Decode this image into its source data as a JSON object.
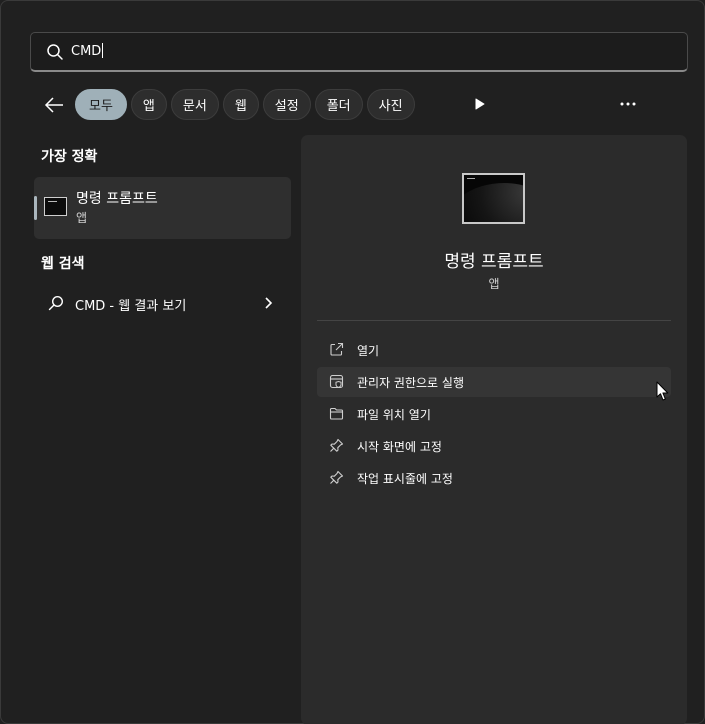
{
  "search": {
    "value": "CMD"
  },
  "filters": [
    "모두",
    "앱",
    "문서",
    "웹",
    "설정",
    "폴더",
    "사진"
  ],
  "best_match": {
    "heading": "가장 정확",
    "name": "명령 프롬프트",
    "type": "앱"
  },
  "web_search": {
    "heading": "웹 검색",
    "text": "CMD - 웹 결과 보기"
  },
  "detail": {
    "title": "명령 프롬프트",
    "subtitle": "앱",
    "actions": [
      {
        "label": "열기",
        "icon": "open-external-icon"
      },
      {
        "label": "관리자 권한으로 실행",
        "icon": "shield-icon"
      },
      {
        "label": "파일 위치 열기",
        "icon": "folder-icon"
      },
      {
        "label": "시작 화면에 고정",
        "icon": "pin-icon"
      },
      {
        "label": "작업 표시줄에 고정",
        "icon": "pin-icon"
      }
    ]
  },
  "colors": {
    "background": "#202020",
    "panel": "#2b2b2b",
    "active_chip": "#9fb0b8"
  }
}
